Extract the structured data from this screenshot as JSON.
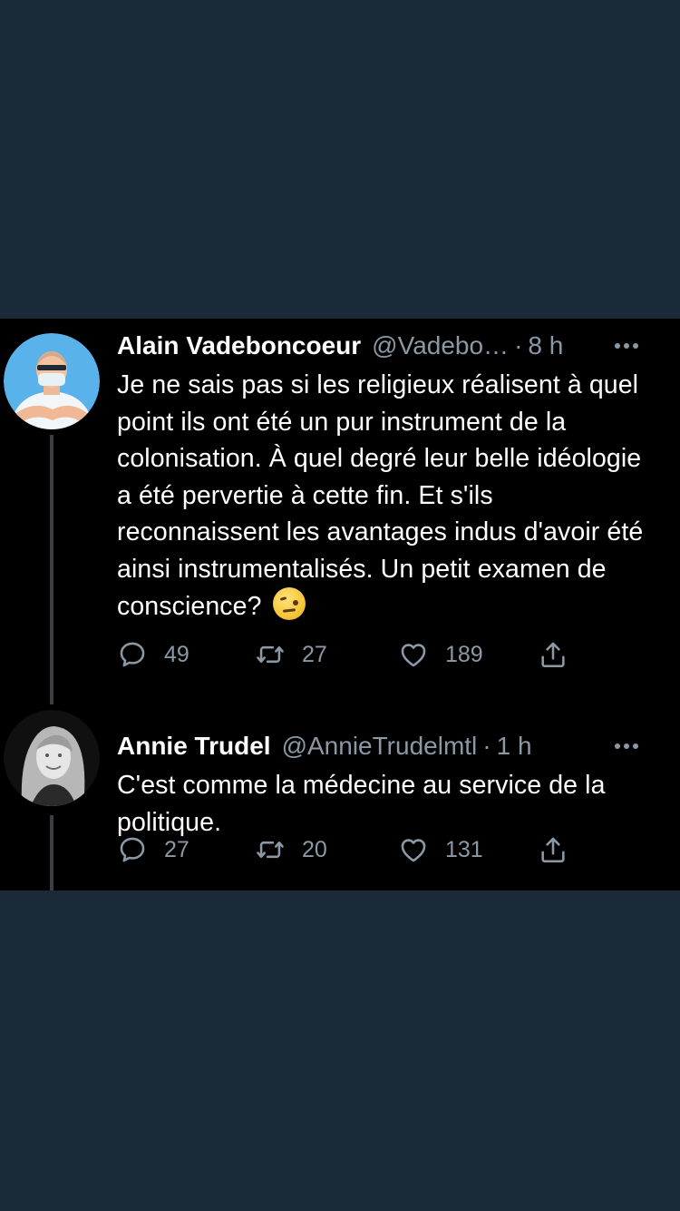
{
  "tweets": [
    {
      "name": "Alain Vadeboncoeur",
      "handle": "@Vadebo…",
      "separator": "·",
      "time": "8 h",
      "text": "Je ne sais pas si les religieux réalisent à quel point ils ont été un pur instrument de la colonisation. À quel degré leur belle idéologie a été pervertie à cette fin. Et s'ils reconnaissent les avantages indus d'avoir été ainsi instrumentalisés. Un petit examen de conscience?",
      "emoji": "face-with-raised-eyebrow",
      "replies": "49",
      "retweets": "27",
      "likes": "189"
    },
    {
      "name": "Annie Trudel",
      "handle": "@AnnieTrudelmtl",
      "separator": "·",
      "time": "1 h",
      "text": "C'est comme la médecine au service de la politique.",
      "replies": "27",
      "retweets": "20",
      "likes": "131"
    }
  ],
  "colors": {
    "outer_background": "#1b2a38",
    "panel_background": "#000000",
    "primary_text": "#ffffff",
    "secondary_text": "#8b98a5"
  },
  "icons": [
    "reply-icon",
    "retweet-icon",
    "like-icon",
    "share-icon",
    "more-icon"
  ]
}
